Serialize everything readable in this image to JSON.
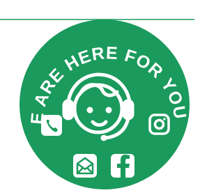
{
  "badge": {
    "text": "WE ARE HERE FOR YOU!",
    "colors": {
      "green": "#1a9a5c",
      "white": "#ffffff",
      "line": "#1a9a5c"
    }
  },
  "icons": {
    "phone": "phone-icon",
    "email": "email-icon",
    "facebook": "facebook-icon",
    "instagram": "instagram-icon"
  }
}
